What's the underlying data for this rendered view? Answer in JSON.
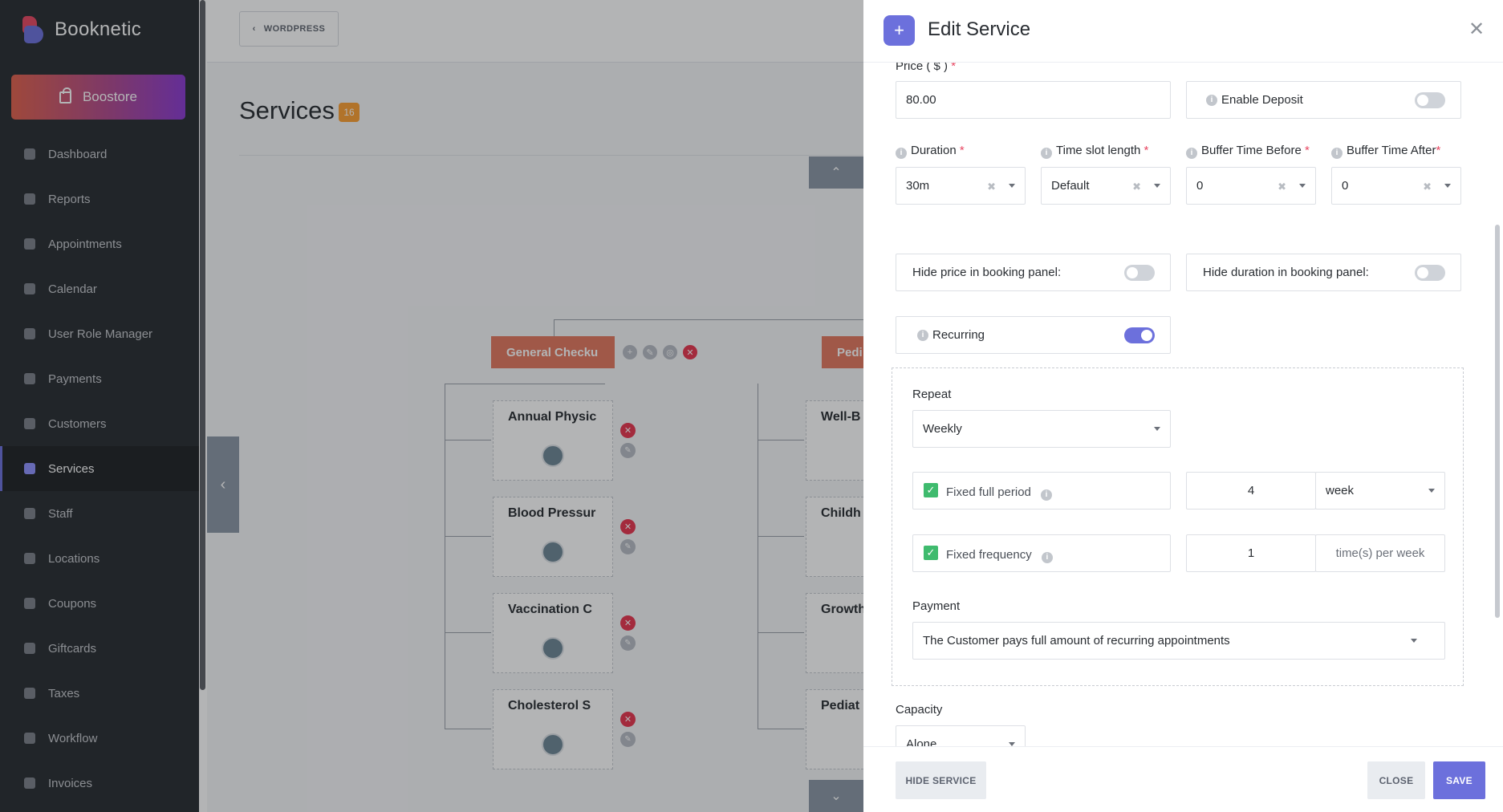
{
  "sidebar": {
    "logo_text": "Booknetic",
    "boostore_label": "Boostore",
    "items": [
      {
        "label": "Dashboard"
      },
      {
        "label": "Reports"
      },
      {
        "label": "Appointments"
      },
      {
        "label": "Calendar"
      },
      {
        "label": "User Role Manager"
      },
      {
        "label": "Payments"
      },
      {
        "label": "Customers"
      },
      {
        "label": "Services"
      },
      {
        "label": "Staff"
      },
      {
        "label": "Locations"
      },
      {
        "label": "Coupons"
      },
      {
        "label": "Giftcards"
      },
      {
        "label": "Taxes"
      },
      {
        "label": "Workflow"
      },
      {
        "label": "Invoices"
      }
    ],
    "active_item": "Services"
  },
  "main": {
    "wordpress_button": "WORDPRESS",
    "page_title": "Services",
    "services_count": "16",
    "categories": [
      {
        "label": "General Checku"
      },
      {
        "label": "Pedi"
      }
    ],
    "general_cards": [
      {
        "title": "Annual Physic"
      },
      {
        "title": "Blood Pressur"
      },
      {
        "title": "Vaccination C"
      },
      {
        "title": "Cholesterol S"
      }
    ],
    "pediatric_cards": [
      {
        "title": "Well-B"
      },
      {
        "title": "Childh"
      },
      {
        "title": "Growth"
      },
      {
        "title": "Pediat"
      }
    ]
  },
  "panel": {
    "title": "Edit Service",
    "price_label": "Price ( $ )",
    "price_value": "80.00",
    "enable_deposit_label": "Enable Deposit",
    "enable_deposit_on": false,
    "duration_label": "Duration",
    "duration_value": "30m",
    "timeslot_label": "Time slot length",
    "timeslot_value": "Default",
    "buffer_before_label": "Buffer Time Before",
    "buffer_before_value": "0",
    "buffer_after_label": "Buffer Time After",
    "buffer_after_value": "0",
    "hide_price_label": "Hide price in booking panel:",
    "hide_price_on": false,
    "hide_duration_label": "Hide duration in booking panel:",
    "hide_duration_on": false,
    "recurring_label": "Recurring",
    "recurring_on": true,
    "repeat_label": "Repeat",
    "repeat_value": "Weekly",
    "fixed_full_period_label": "Fixed full period",
    "fixed_full_period_checked": true,
    "full_period_value": "4",
    "full_period_unit": "week",
    "fixed_frequency_label": "Fixed frequency",
    "fixed_frequency_checked": true,
    "frequency_value": "1",
    "frequency_unit": "time(s) per week",
    "payment_label": "Payment",
    "payment_value": "The Customer pays full amount of recurring appointments",
    "capacity_label": "Capacity",
    "capacity_value": "Alone",
    "hide_service_button": "HIDE SERVICE",
    "close_button": "CLOSE",
    "save_button": "SAVE"
  },
  "colors": {
    "accent": "#6c70dc",
    "sidebar_bg": "#292d32",
    "category_bg": "#e3785f",
    "danger": "#e8364f",
    "check_green": "#3fbb6e",
    "badge_orange": "#fca033"
  },
  "icons": {
    "boostore": "shopping-bag-icon",
    "close": "close-icon",
    "add": "plus-icon",
    "info": "info-icon",
    "check": "checkmark-icon"
  }
}
